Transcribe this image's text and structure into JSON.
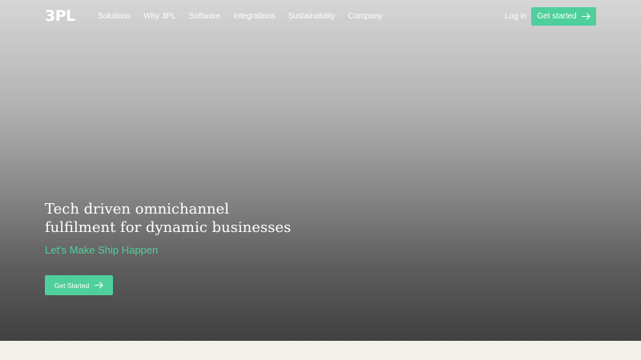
{
  "header": {
    "logo": "3PL",
    "nav": [
      {
        "label": "Solutions"
      },
      {
        "label": "Why 3PL"
      },
      {
        "label": "Software"
      },
      {
        "label": "Integrations"
      },
      {
        "label": "Sustainability"
      },
      {
        "label": "Company"
      }
    ],
    "login_label": "Log in",
    "cta_label": "Get started",
    "cta_icon": "arrow-right-icon"
  },
  "hero": {
    "headline_line1": "Tech driven omnichannel",
    "headline_line2": "fulfilment for dynamic businesses",
    "tagline": "Let's Make Ship Happen",
    "cta_label": "Get Started",
    "cta_icon": "arrow-right-icon"
  },
  "colors": {
    "accent": "#4fcf9c",
    "text_on_dark": "#ffffff",
    "hero_top": "#d6d6d6",
    "hero_bottom": "#404040",
    "page_background": "#f3f0ec"
  }
}
